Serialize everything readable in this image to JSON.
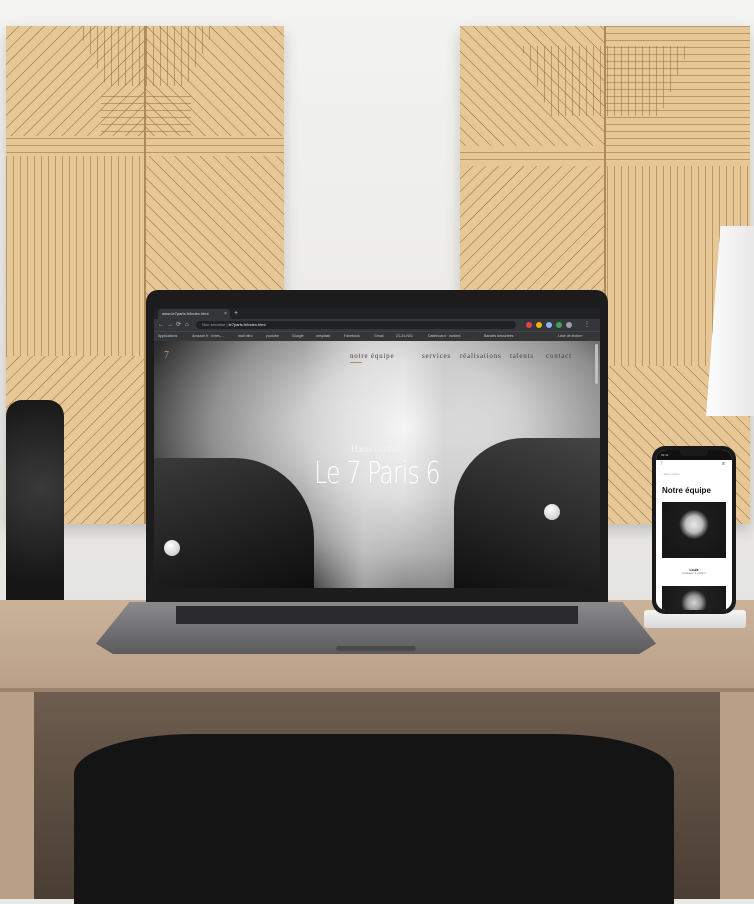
{
  "browser": {
    "tab_title": "www.le7paris.fr/index.html",
    "tab_close": "×",
    "new_tab": "+",
    "nav": {
      "back": "←",
      "forward": "→",
      "reload": "⟳",
      "home": "⌂"
    },
    "security_label": "Non sécurisé",
    "url": "le7paris.fr/index.html",
    "bookmarks": [
      "Applications",
      "Amazon.fr : livres,...",
      "mail nitro",
      "youtube",
      "Google",
      "unsplash",
      "Facebook",
      "Gmail",
      "21-24-N01",
      "Dashboard · Invided",
      "Bandes dessinées",
      "Liste de lecture"
    ],
    "ext_colors": [
      "#e0454b",
      "#f4b400",
      "#8ab4f8",
      "#34a853",
      "#9aa0a6"
    ]
  },
  "site": {
    "logo": "7",
    "nav": [
      "notre équipe",
      "services",
      "réalisations",
      "talents",
      "contact"
    ],
    "hero_subtitle": "Haute coiffure",
    "hero_title": "Le 7 Paris 6"
  },
  "phone": {
    "status_time": "09:41",
    "logo": "7",
    "menu_icon": "≡",
    "breadcrumb": "‹ Notre équipe",
    "heading": "Notre équipe",
    "member_name": "Louis",
    "member_role": "Fondateur & coiffeur"
  },
  "colors": {
    "accent_gold": "#b88d53",
    "wood_panel": "#e6c795"
  }
}
